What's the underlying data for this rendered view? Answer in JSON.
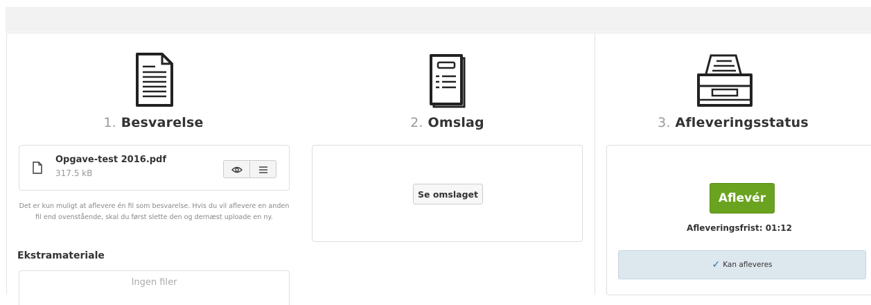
{
  "steps": [
    {
      "number": "1.",
      "title": "Besvarelse",
      "icon": "document-icon"
    },
    {
      "number": "2.",
      "title": "Omslag",
      "icon": "cover-icon"
    },
    {
      "number": "3.",
      "title": "Afleveringsstatus",
      "icon": "filing-tray-icon"
    }
  ],
  "answer": {
    "file_name": "Opgave-test 2016.pdf",
    "file_size": "317.5 kB",
    "note": "Det er kun muligt at aflevere én fil som besvarelse. Hvis du vil aflevere en anden fil end ovenstående, skal du først slette den og dernæst uploade en ny.",
    "extra_title": "Ekstramateriale",
    "no_files": "Ingen filer"
  },
  "cover": {
    "button_label": "Se omslaget"
  },
  "status": {
    "submit_label": "Aflevér",
    "deadline": "Afleveringsfrist: 01:12",
    "badge": "Kan afleveres"
  },
  "colors": {
    "submit": "#6aa31f",
    "badge_bg": "#dde7ee",
    "check": "#2f6aa0"
  }
}
